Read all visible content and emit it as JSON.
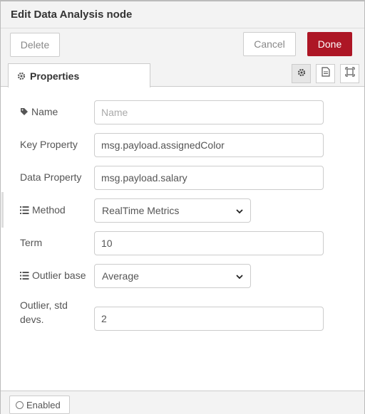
{
  "header": {
    "title": "Edit Data Analysis node"
  },
  "toolbar": {
    "delete_label": "Delete",
    "cancel_label": "Cancel",
    "done_label": "Done"
  },
  "tabs": {
    "properties_label": "Properties"
  },
  "fields": {
    "name": {
      "label": "Name",
      "value": "",
      "placeholder": "Name"
    },
    "key_property": {
      "label": "Key Property",
      "value": "msg.payload.assignedColor"
    },
    "data_property": {
      "label": "Data Property",
      "value": "msg.payload.salary"
    },
    "method": {
      "label": "Method",
      "value": "RealTime Metrics"
    },
    "term": {
      "label": "Term",
      "value": "10"
    },
    "outlier_base": {
      "label": "Outlier base",
      "value": "Average"
    },
    "outlier_std": {
      "label_line1": "Outlier, std",
      "label_line2": "devs.",
      "value": "2"
    }
  },
  "footer": {
    "enabled_label": "Enabled"
  },
  "colors": {
    "done": "#ad1625",
    "panel": "#f3f3f3",
    "border": "#cccccc"
  },
  "icons": [
    "gear-icon",
    "tag-icon",
    "list-icon",
    "document-icon",
    "frame-icon",
    "circle-icon",
    "chevron-down-icon"
  ]
}
